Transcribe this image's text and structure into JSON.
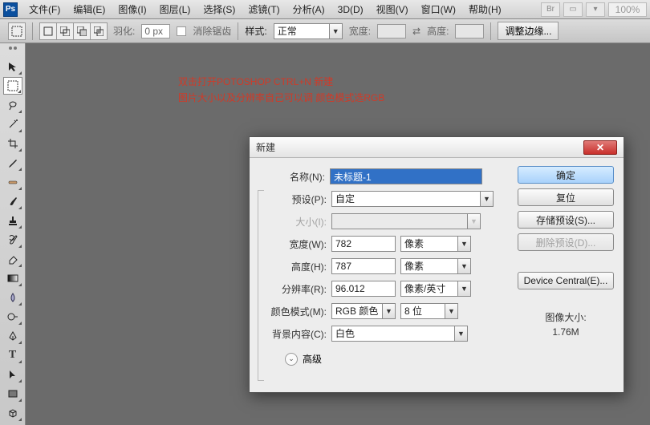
{
  "menubar": {
    "items": [
      "文件(F)",
      "编辑(E)",
      "图像(I)",
      "图层(L)",
      "选择(S)",
      "滤镜(T)",
      "分析(A)",
      "3D(D)",
      "视图(V)",
      "窗口(W)",
      "帮助(H)"
    ],
    "zoom": "100%"
  },
  "optionsbar": {
    "feather_label": "羽化:",
    "feather_value": "0 px",
    "antialias_label": "消除锯齿",
    "style_label": "样式:",
    "style_value": "正常",
    "width_label": "宽度:",
    "height_label": "高度:",
    "refine_edge": "调整边缘..."
  },
  "overlay": {
    "line1": "双击打开POTOSHOP CTRL+N 新建",
    "line2": "图片大小以及分辨率自己可以调 颜色模式选RGB"
  },
  "dialog": {
    "title": "新建",
    "name_label": "名称(N):",
    "name_value": "未标题-1",
    "preset_label": "预设(P):",
    "preset_value": "自定",
    "size_label": "大小(I):",
    "width_label": "宽度(W):",
    "width_value": "782",
    "width_unit": "像素",
    "height_label": "高度(H):",
    "height_value": "787",
    "height_unit": "像素",
    "res_label": "分辨率(R):",
    "res_value": "96.012",
    "res_unit": "像素/英寸",
    "mode_label": "颜色模式(M):",
    "mode_value": "RGB 颜色",
    "depth_value": "8 位",
    "bg_label": "背景内容(C):",
    "bg_value": "白色",
    "advanced": "高级",
    "ok": "确定",
    "reset": "复位",
    "save_preset": "存储预设(S)...",
    "delete_preset": "删除预设(D)...",
    "device_central": "Device Central(E)...",
    "img_size_label": "图像大小:",
    "img_size_value": "1.76M"
  }
}
